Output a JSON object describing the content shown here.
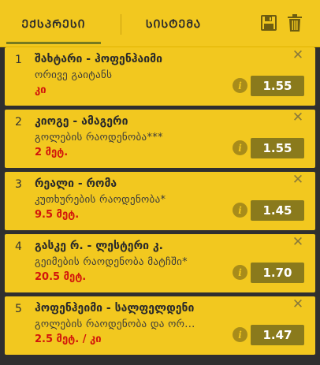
{
  "tabs": {
    "express_label": "ᲔᲥᲡᲞᲠᲔᲡᲘ",
    "system_label": "ᲡᲘᲡᲢᲔᲛᲐ",
    "active": "express"
  },
  "toolbar": {
    "save_icon": "floppy-disk-icon",
    "delete_icon": "trash-icon"
  },
  "colors": {
    "accent": "#f2c81f",
    "odds_bg": "#8a7a1c",
    "pick_red": "#d2160c"
  },
  "bets": [
    {
      "num": "1",
      "match": "შახტარი - ჰოფენჰაიმი",
      "market": "ორივე გაიტანს",
      "pick": "კი",
      "odds": "1.55"
    },
    {
      "num": "2",
      "match": "კიოგე - ამაგერი",
      "market": "გოლების რაოდენობა***",
      "pick": "2 მეტ.",
      "odds": "1.55"
    },
    {
      "num": "3",
      "match": "რეალი - რომა",
      "market": "კუთხურების რაოდენობა*",
      "pick": "9.5 მეტ.",
      "odds": "1.45"
    },
    {
      "num": "4",
      "match": "გასკე რ. - ლესტერი კ.",
      "market": "გეიმების რაოდენობა მატჩში*",
      "pick": "20.5 მეტ.",
      "odds": "1.70"
    },
    {
      "num": "5",
      "match": "ჰოფენჰეიმი - სალფელდენი",
      "market": "გოლების რაოდენობა და ორ...",
      "pick": "2.5 მეტ. / კი",
      "odds": "1.47"
    }
  ]
}
